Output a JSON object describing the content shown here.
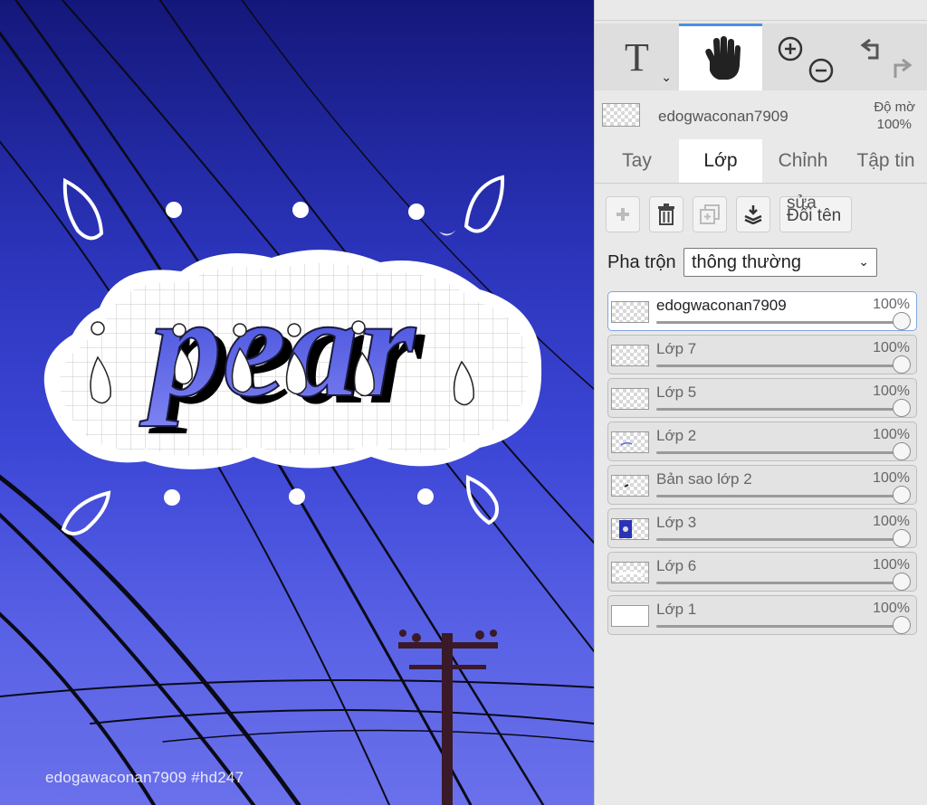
{
  "canvas": {
    "artwork_text": "pear",
    "watermark": "edogawaconan7909   #hd247",
    "colors": {
      "sky_top": "#14177a",
      "sky_bottom": "#6a70ea",
      "letter": "#5a62e8",
      "accent_white": "#ffffff"
    }
  },
  "toolbar": {
    "text_tool": "T",
    "text_tool_dropdown": "⌄",
    "active_tool": "hand"
  },
  "layer_header": {
    "name": "edogwaconan7909",
    "opacity_label": "Độ mờ",
    "opacity_value": "100%"
  },
  "tabs": [
    {
      "label": "Tay"
    },
    {
      "label": "Lớp",
      "active": true
    },
    {
      "label": "Chỉnh"
    },
    {
      "label": "Tập tin"
    }
  ],
  "actions": {
    "rename_line1": "sửa",
    "rename_line2": "Đổi tên",
    "icons": [
      "plus-icon",
      "trash-icon",
      "duplicate-icon",
      "merge-down-icon"
    ]
  },
  "blend": {
    "label": "Pha trộn",
    "value": "thông thường"
  },
  "layers": [
    {
      "name": "edogwaconan7909",
      "opacity": "100%",
      "selected": true
    },
    {
      "name": "Lớp 7",
      "opacity": "100%"
    },
    {
      "name": "Lớp 5",
      "opacity": "100%"
    },
    {
      "name": "Lớp 2",
      "opacity": "100%"
    },
    {
      "name": "Bản sao lớp 2",
      "opacity": "100%"
    },
    {
      "name": "Lớp 3",
      "opacity": "100%"
    },
    {
      "name": "Lớp 6",
      "opacity": "100%"
    },
    {
      "name": "Lớp 1",
      "opacity": "100%"
    }
  ]
}
